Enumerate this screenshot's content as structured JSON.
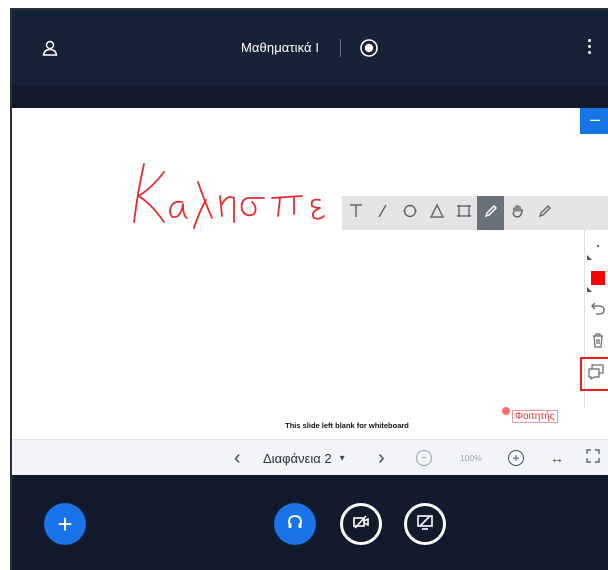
{
  "header": {
    "title": "Μαθηματικά Ι",
    "user_icon": "user-icon",
    "record_icon": "record-icon",
    "more_icon": "more-vertical-icon"
  },
  "slide": {
    "collapse_label": "–",
    "handwriting_text": "Καλησπε",
    "caption": "This slide left blank for whiteboard",
    "cursor_user_label": "Φοιτητής"
  },
  "whiteboard_tools": [
    {
      "name": "text-tool",
      "icon": "text-icon"
    },
    {
      "name": "line-tool",
      "icon": "line-icon"
    },
    {
      "name": "ellipse-tool",
      "icon": "ellipse-icon"
    },
    {
      "name": "triangle-tool",
      "icon": "triangle-icon"
    },
    {
      "name": "rectangle-tool",
      "icon": "rectangle-icon"
    },
    {
      "name": "pencil-tool",
      "icon": "pencil-icon",
      "active": true
    },
    {
      "name": "pan-tool",
      "icon": "hand-icon"
    },
    {
      "name": "pen-tool",
      "icon": "pencil-icon"
    }
  ],
  "whiteboard_side": {
    "thickness": "·",
    "color": "#ff0000",
    "undo_icon": "undo-icon",
    "clear_icon": "trash-icon",
    "multiuser_icon": "multi-user-whiteboard-icon"
  },
  "pagination": {
    "prev_label": "‹",
    "slide_label": "Διαφάνεια 2",
    "dropdown_arrow": "▾",
    "next_label": "›",
    "zoom_out_label": "−",
    "zoom_level": "100%",
    "zoom_in_label": "+",
    "fit_width_label": "↔",
    "fullscreen_icon": "fullscreen-icon"
  },
  "bottom_bar": {
    "actions_label": "+",
    "audio_icon": "headphones-icon",
    "video_icon": "camera-off-icon",
    "screenshare_icon": "screenshare-off-icon"
  },
  "colors": {
    "header_bg": "#162337",
    "bottom_bg": "#111b2b",
    "accent_blue": "#1a73e8",
    "ink_red": "#e42b2b",
    "highlight_red": "#e52220"
  }
}
